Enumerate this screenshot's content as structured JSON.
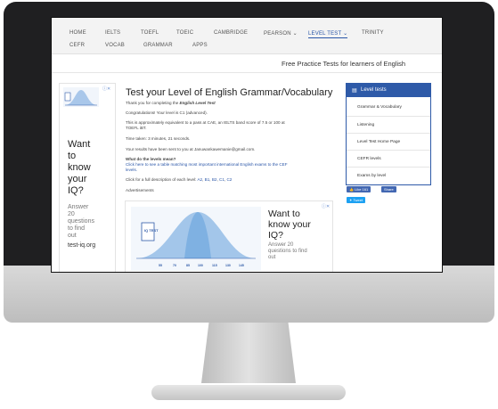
{
  "nav": {
    "row1": [
      "HOME",
      "IELTS",
      "TOEFL",
      "TOEIC",
      "CAMBRIDGE",
      "PEARSON",
      "LEVEL TEST",
      "TRINITY"
    ],
    "row2": [
      "CEFR",
      "VOCAB",
      "GRAMMAR",
      "APPS"
    ],
    "active": "LEVEL TEST"
  },
  "tagline": "Free Practice Tests for learners of English",
  "left_ad": {
    "headline": [
      "Want",
      "to",
      "know",
      "your",
      "IQ?"
    ],
    "body": [
      "Answer",
      "20",
      "questions",
      "to find",
      "out"
    ],
    "domain": "test-iq.org",
    "iq_label": "IQ TEST"
  },
  "main": {
    "title": "Test your Level of English Grammar/Vocabulary",
    "thanks_prefix": "Thank you for completing the ",
    "thanks_test": "English Level Test",
    "congrats": "Congratulations! Your level is C1 (advanced).",
    "equiv_line1": "This is approximately equivalent to a pass at CAE, an IELTS band score of 7.5 or 100 at",
    "equiv_line2": "TOEFL iBT.",
    "time": "Time taken: 3 minutes, 21 seconds.",
    "sent": "Your results have been sent to you at Januwankawemanie@gmail.com.",
    "levels_q": "What do the levels mean?",
    "table_link_line1": "Click here to see a table matching most important international English exams to the CEF",
    "table_link_line2": "levels.",
    "full_desc_prefix": "Click for a full description of each level: ",
    "levels_links": [
      "A2",
      "B1",
      "B2",
      "C1",
      "C2"
    ],
    "ads_label": "Advertisements"
  },
  "bottom_ad": {
    "headline": [
      "Want to",
      "know your",
      "IQ?"
    ],
    "body": [
      "Answer 20",
      "questions to find",
      "out"
    ],
    "iq_label": "IQ TEST",
    "axis_ticks": [
      "55",
      "70",
      "85",
      "100",
      "115",
      "130",
      "145"
    ]
  },
  "sidebar": {
    "title": "Level tests",
    "items": [
      "Grammar & Vocabulary",
      "Listening",
      "Level Test Home Page",
      "CEFR levels",
      "Exams by level"
    ]
  },
  "social": {
    "like": "Like 161",
    "share": "Share",
    "tweet": "Tweet"
  },
  "colors": {
    "accent": "#2e5aa8",
    "bezel": "#1f1f21",
    "link": "#2a56a8"
  }
}
